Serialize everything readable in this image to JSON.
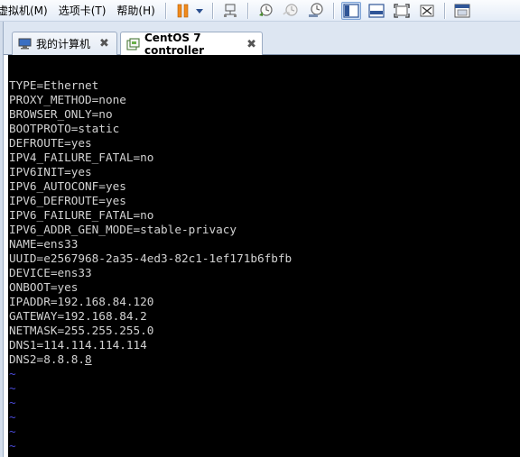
{
  "menu": {
    "items": [
      "虚拟机(M)",
      "选项卡(T)",
      "帮助(H)"
    ]
  },
  "toolbar": {
    "icons": [
      "pause-icon",
      "dropdown-icon",
      "network-icon",
      "snapshot-icon",
      "revert-snapshot-icon",
      "snapshot-manager-icon",
      "console-view-icon",
      "fullscreen-bar-icon",
      "fullscreen-icon",
      "unity-icon",
      "thumbnail-icon"
    ]
  },
  "tabs": [
    {
      "label": "我的计算机",
      "close": "✖",
      "icon": "computer-icon"
    },
    {
      "label": "CentOS 7 controller",
      "close": "✖",
      "icon": "vm-icon",
      "active": true
    }
  ],
  "colors": {
    "terminal_bg": "#000000",
    "terminal_fg": "#d2d2d2",
    "tilde": "#4a4ad8",
    "pause_orange": "#f08a1c"
  },
  "terminal": {
    "lines": [
      "TYPE=Ethernet",
      "PROXY_METHOD=none",
      "BROWSER_ONLY=no",
      "BOOTPROTO=static",
      "DEFROUTE=yes",
      "IPV4_FAILURE_FATAL=no",
      "IPV6INIT=yes",
      "IPV6_AUTOCONF=yes",
      "IPV6_DEFROUTE=yes",
      "IPV6_FAILURE_FATAL=no",
      "IPV6_ADDR_GEN_MODE=stable-privacy",
      "NAME=ens33",
      "UUID=e2567968-2a35-4ed3-82c1-1ef171b6fbfb",
      "DEVICE=ens33",
      "ONBOOT=yes",
      "IPADDR=192.168.84.120",
      "GATEWAY=192.168.84.2",
      "NETMASK=255.255.255.0",
      "DNS1=114.114.114.114"
    ],
    "last_line_prefix": "DNS2=8.8.8.",
    "cursor_char": "8",
    "tilde": "~",
    "tilde_count": 6
  }
}
